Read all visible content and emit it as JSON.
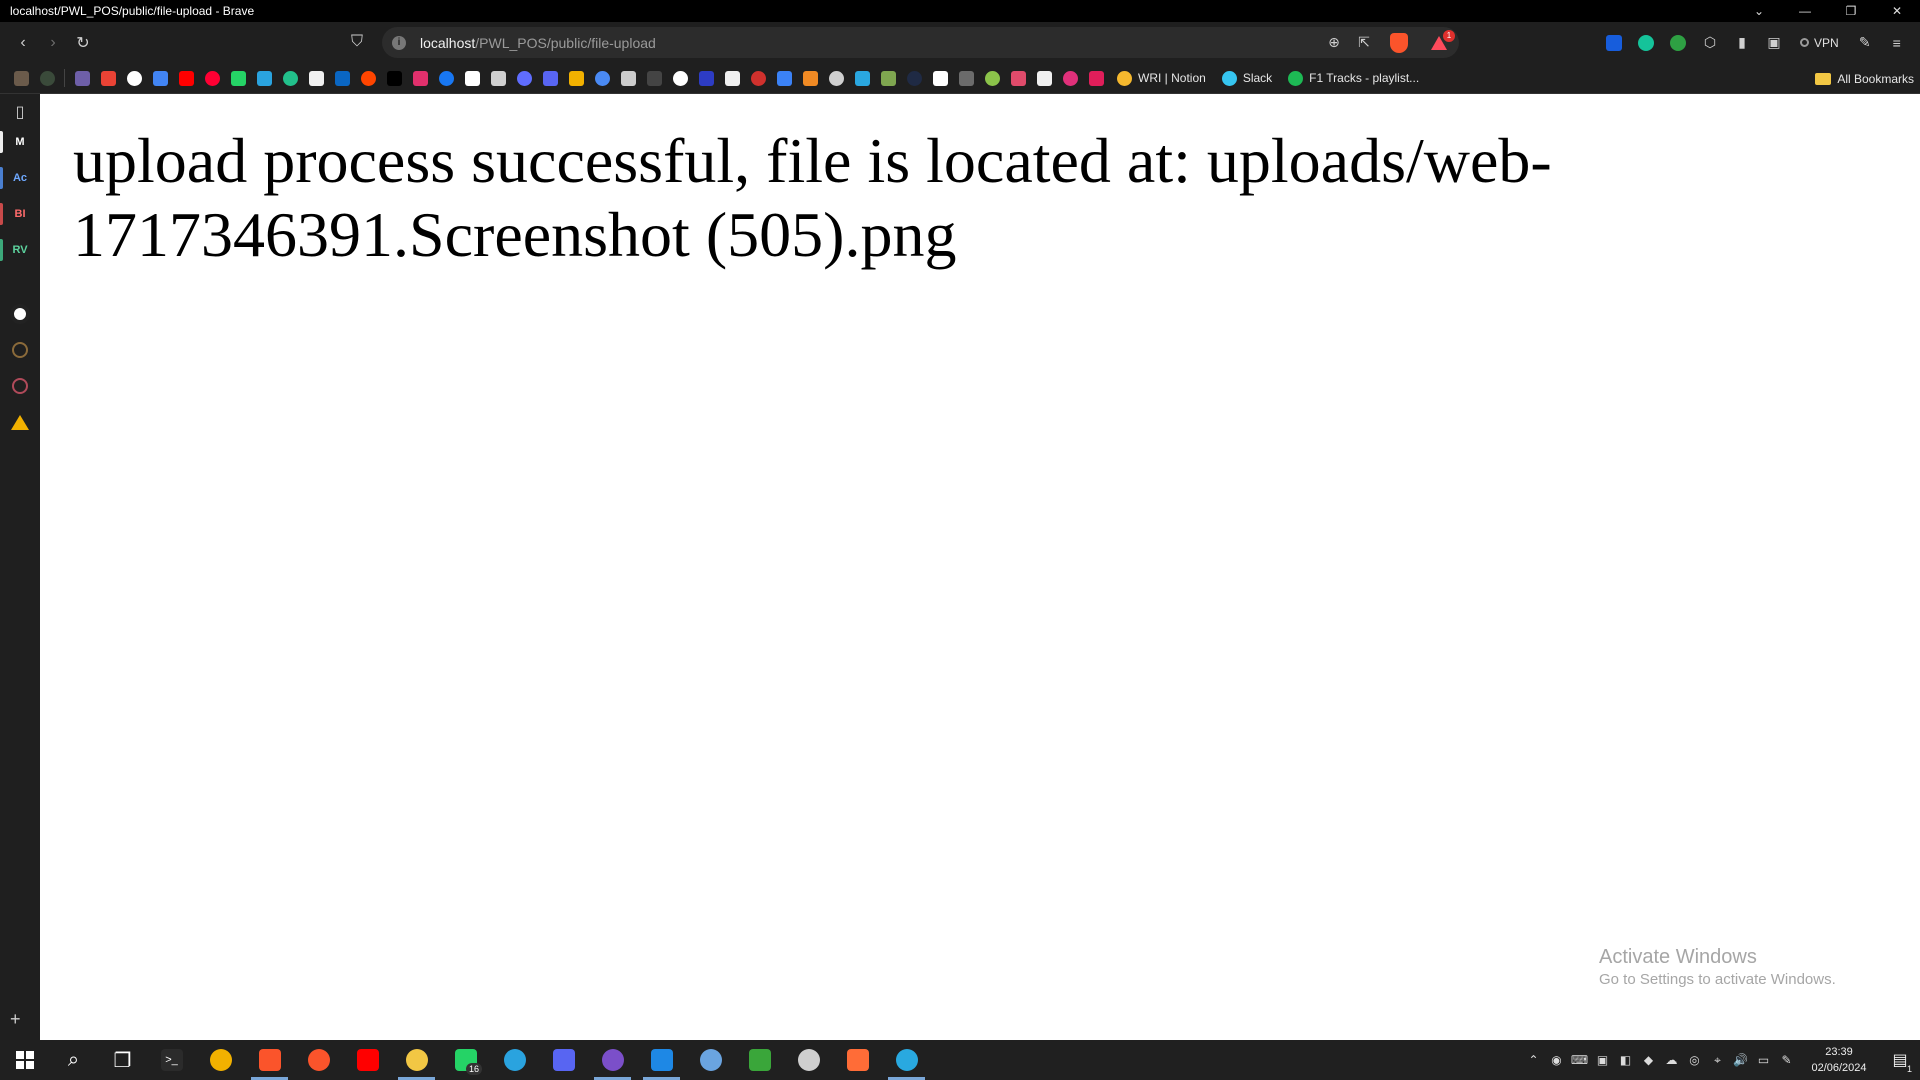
{
  "window": {
    "title": "localhost/PWL_POS/public/file-upload - Brave",
    "controls": [
      "⌄",
      "—",
      "❐",
      "✕"
    ]
  },
  "toolbar": {
    "back_glyph": "‹",
    "forward_glyph": "›",
    "reload_glyph": "↻",
    "bookmark_glyph": "⛉",
    "url_host": "localhost",
    "url_path": "/PWL_POS/public/file-upload",
    "rewards_count": "1",
    "vpn_label": "VPN"
  },
  "bookmarks": {
    "icons": [
      {
        "name": "bookmark-app-1-icon",
        "color": "#6b5b4b"
      },
      {
        "name": "bookmark-app-2-icon",
        "color": "#3a4a3a"
      },
      {
        "name": "bookmark-site-icon",
        "color": "#6e5fa8"
      },
      {
        "name": "gmail-icon",
        "color": "#ea4335"
      },
      {
        "name": "google-icon",
        "color": "#ffffff"
      },
      {
        "name": "google-meet-icon",
        "color": "#4285f4"
      },
      {
        "name": "youtube-icon",
        "color": "#ff0000"
      },
      {
        "name": "youtube-music-icon",
        "color": "#ff0033"
      },
      {
        "name": "whatsapp-icon",
        "color": "#25d366"
      },
      {
        "name": "telegram-icon",
        "color": "#2aa3df"
      },
      {
        "name": "perplexity-icon",
        "color": "#22c08b"
      },
      {
        "name": "github-icon",
        "color": "#f0f0f0"
      },
      {
        "name": "linkedin-icon",
        "color": "#0a66c2"
      },
      {
        "name": "reddit-icon",
        "color": "#ff4500"
      },
      {
        "name": "x-twitter-icon",
        "color": "#000000"
      },
      {
        "name": "instagram-icon",
        "color": "#e1306c"
      },
      {
        "name": "facebook-icon",
        "color": "#1877f2"
      },
      {
        "name": "notion-icon",
        "color": "#ffffff"
      },
      {
        "name": "chatgpt-icon",
        "color": "#d0d0d0"
      },
      {
        "name": "bookmark-blue-icon",
        "color": "#5f6dff"
      },
      {
        "name": "discord-icon",
        "color": "#5865f2"
      },
      {
        "name": "photos-icon",
        "color": "#f2b100"
      },
      {
        "name": "translate-icon",
        "color": "#4a8af4"
      },
      {
        "name": "copilot-icon",
        "color": "#cccccc"
      },
      {
        "name": "bookmark-a-icon",
        "color": "#444444"
      },
      {
        "name": "download-icon",
        "color": "#ffffff"
      },
      {
        "name": "bookmark-code-icon",
        "color": "#2d3cc4"
      },
      {
        "name": "bookmark-globe-icon",
        "color": "#f0f0f0"
      },
      {
        "name": "bookmark-red-icon",
        "color": "#d0312d"
      },
      {
        "name": "share-icon",
        "color": "#3b82f6"
      },
      {
        "name": "bookmark-orange-icon",
        "color": "#f08a24"
      },
      {
        "name": "bookmark-doc-icon",
        "color": "#cfcfcf"
      },
      {
        "name": "bookmark-c-icon",
        "color": "#2aa7e0"
      },
      {
        "name": "bookmark-chess-icon",
        "color": "#7fa650"
      },
      {
        "name": "bookmark-dark-icon",
        "color": "#1f2a44"
      },
      {
        "name": "bookmark-arrow-icon",
        "color": "#ffffff"
      },
      {
        "name": "bookmark-h-icon",
        "color": "#6b6b6b"
      },
      {
        "name": "bookmark-cube-icon",
        "color": "#8bc34a"
      },
      {
        "name": "bookmark-pink-icon",
        "color": "#e04b6b"
      },
      {
        "name": "bookmark-globe2-icon",
        "color": "#f0f0f0"
      },
      {
        "name": "bookmark-magenta-icon",
        "color": "#e0307a"
      },
      {
        "name": "slack-small-icon",
        "color": "#e01e5a"
      }
    ],
    "named": [
      {
        "label": "WRI | Notion",
        "color": "#f5b82e"
      },
      {
        "label": "Slack",
        "color": "#36c5f0"
      },
      {
        "label": "F1 Tracks - playlist...",
        "color": "#1db954"
      }
    ],
    "all_label": "All Bookmarks"
  },
  "sidebar": {
    "items": [
      {
        "label": "M",
        "color": "#ffffff",
        "mark": "#eeeeee"
      },
      {
        "label": "Ac",
        "color": "#6ea8fe",
        "mark": "#4a7fd0"
      },
      {
        "label": "BI",
        "color": "#ff6b6b",
        "mark": "#c84a4a"
      },
      {
        "label": "RV",
        "color": "#5dd39e",
        "mark": "#3ca87a"
      }
    ],
    "plus": "+"
  },
  "page": {
    "message": "upload process successful, file is located at: uploads/web-1717346391.Screenshot (505).png"
  },
  "watermark": {
    "line1": "Activate Windows",
    "line2": "Go to Settings to activate Windows."
  },
  "taskbar": {
    "apps": [
      {
        "name": "search-icon",
        "glyph": "⌕",
        "color": ""
      },
      {
        "name": "task-view-icon",
        "glyph": "❐",
        "color": ""
      },
      {
        "name": "terminal-icon",
        "glyph": ">_",
        "color": "#2b2b2b"
      },
      {
        "name": "chrome-icon",
        "glyph": "",
        "color": "#f2b100"
      },
      {
        "name": "brave-taskbar-1-icon",
        "glyph": "",
        "color": "#fb542b",
        "active": true
      },
      {
        "name": "brave-taskbar-2-icon",
        "glyph": "",
        "color": "#fb542b"
      },
      {
        "name": "youtube-music-taskbar-icon",
        "glyph": "",
        "color": "#ff0000"
      },
      {
        "name": "file-explorer-icon",
        "glyph": "",
        "color": "#f2c744",
        "active": true
      },
      {
        "name": "whatsapp-taskbar-icon",
        "glyph": "",
        "color": "#25d366",
        "badge": "16"
      },
      {
        "name": "telegram-taskbar-icon",
        "glyph": "",
        "color": "#2aa3df"
      },
      {
        "name": "discord-taskbar-icon",
        "glyph": "",
        "color": "#5865f2"
      },
      {
        "name": "github-desktop-icon",
        "glyph": "",
        "color": "#7b4fc9",
        "active": true
      },
      {
        "name": "vscode-icon",
        "glyph": "",
        "color": "#1e88e5",
        "active": true
      },
      {
        "name": "remote-desktop-icon",
        "glyph": "",
        "color": "#6aa4e0"
      },
      {
        "name": "minecraft-icon",
        "glyph": "",
        "color": "#3aa63a"
      },
      {
        "name": "app-window-icon",
        "glyph": "",
        "color": "#cfcfcf"
      },
      {
        "name": "postman-icon",
        "glyph": "",
        "color": "#ff6c37"
      },
      {
        "name": "app-blue-icon",
        "glyph": "",
        "color": "#29a9e0",
        "active": true
      }
    ],
    "tray": [
      "⌃",
      "◉",
      "⌨",
      "▣",
      "◧",
      "◆",
      "☁",
      "◎",
      "⌖",
      "🔊",
      "▭",
      "✎"
    ],
    "time": "23:39",
    "date": "02/06/2024",
    "notification_count": "1"
  }
}
